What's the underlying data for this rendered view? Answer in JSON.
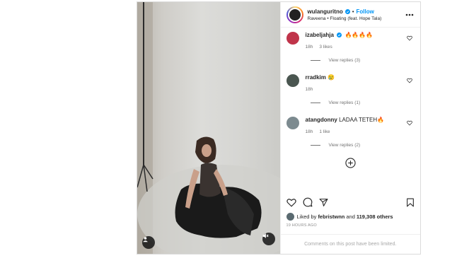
{
  "post": {
    "username": "wulanguritno",
    "follow_label": "Follow",
    "separator": "•",
    "audio": "Raveena • Floating (feat. Hope Tala)",
    "media_user_icon": "user-icon",
    "media_mute_icon": "muted-speaker-icon"
  },
  "comments": [
    {
      "user": "izabeljahja",
      "text": "🔥🔥🔥🔥",
      "time": "18h",
      "likes": "3 likes",
      "replies": "View replies (3)",
      "avatar_color": "#c0344a",
      "verified": true
    },
    {
      "user": "rradkim",
      "text": "😢",
      "time": "18h",
      "likes": "",
      "replies": "View replies (1)",
      "avatar_color": "#4a5650",
      "verified": false
    },
    {
      "user": "atangdonny",
      "text": "LADAA TETEH🔥",
      "time": "18h",
      "likes": "1 like",
      "replies": "View replies (2)",
      "avatar_color": "#7c8a8f",
      "verified": false
    }
  ],
  "actions": {
    "like_icon": "heart-icon",
    "comment_icon": "comment-icon",
    "share_icon": "send-icon",
    "save_icon": "bookmark-icon",
    "load_more_icon": "plus-circle-icon"
  },
  "likes": {
    "prefix": "Liked by",
    "user": "febristwnn",
    "conj": "and",
    "others": "119,308 others"
  },
  "time_ago": "19 HOURS AGO",
  "comments_limited": "Comments on this post have been limited.",
  "colors": {
    "accent": "#0095f6",
    "text": "#262626",
    "muted": "#737373",
    "border": "#dbdbdb"
  }
}
